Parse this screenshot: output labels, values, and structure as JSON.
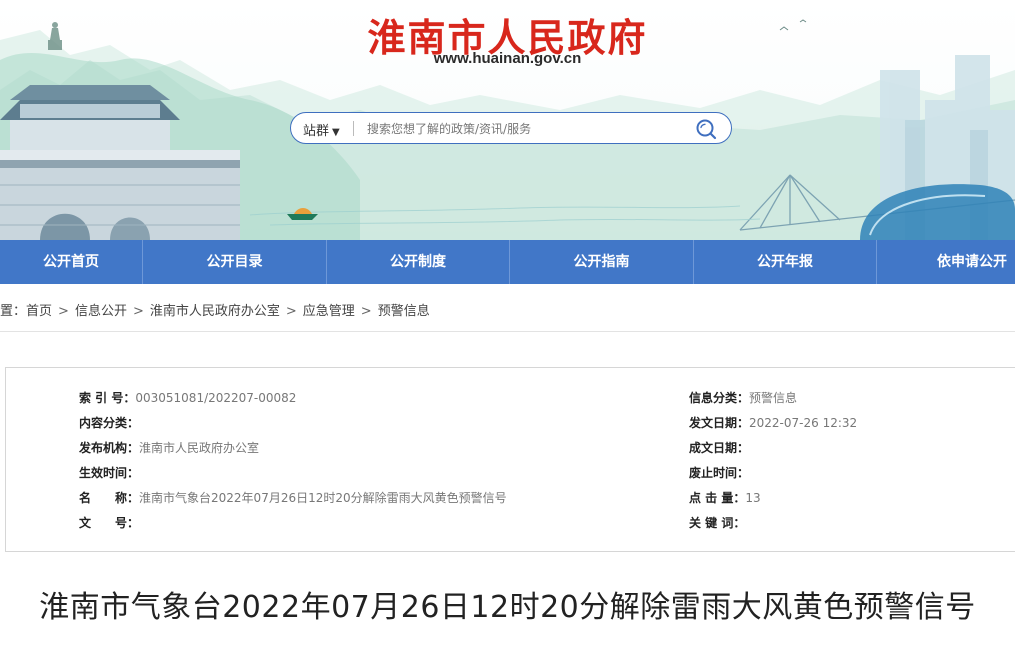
{
  "header": {
    "site_title": "淮南市人民政府",
    "site_url": "www.huainan.gov.cn",
    "search": {
      "scope_label": "站群",
      "placeholder": "搜索您想了解的政策/资讯/服务"
    }
  },
  "nav": {
    "items": [
      {
        "label": "公开首页"
      },
      {
        "label": "公开目录"
      },
      {
        "label": "公开制度"
      },
      {
        "label": "公开指南"
      },
      {
        "label": "公开年报"
      },
      {
        "label": "依申请公开"
      }
    ]
  },
  "breadcrumb": {
    "prefix": "位置：",
    "items": [
      "首页",
      "信息公开",
      "淮南市人民政府办公室",
      "应急管理",
      "预警信息"
    ],
    "separator": ">"
  },
  "meta": {
    "index_no": {
      "label": "索 引 号：",
      "value": "003051081/202207-00082"
    },
    "content_category": {
      "label": "内容分类：",
      "value": ""
    },
    "publisher": {
      "label": "发布机构：",
      "value": "淮南市人民政府办公室"
    },
    "effective_date": {
      "label": "生效时间：",
      "value": ""
    },
    "name": {
      "label": "名　　称：",
      "value": "淮南市气象台2022年07月26日12时20分解除雷雨大风黄色预警信号"
    },
    "doc_no": {
      "label": "文　　号：",
      "value": ""
    },
    "info_category": {
      "label": "信息分类：",
      "value": "预警信息"
    },
    "issue_date": {
      "label": "发文日期：",
      "value": "2022-07-26 12:32"
    },
    "created_date": {
      "label": "成文日期：",
      "value": ""
    },
    "expiry_date": {
      "label": "废止时间：",
      "value": ""
    },
    "views": {
      "label": "点 击 量：",
      "value": "13"
    },
    "keywords": {
      "label": "关 键 词：",
      "value": ""
    }
  },
  "article": {
    "title": "淮南市气象台2022年07月26日12时20分解除雷雨大风黄色预警信号"
  },
  "colors": {
    "title_red": "#d8271c",
    "nav_blue": "#4177c8",
    "search_border": "#3f6fbf"
  }
}
